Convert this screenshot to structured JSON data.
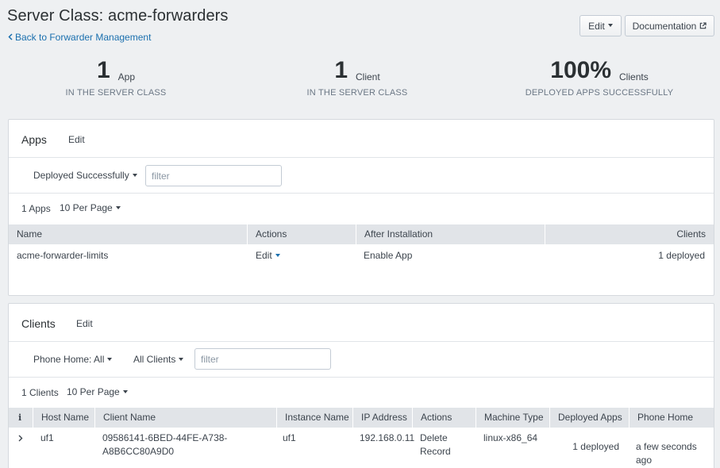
{
  "header": {
    "title": "Server Class: acme-forwarders",
    "back_link": "Back to Forwarder Management",
    "edit_button": "Edit",
    "doc_button": "Documentation"
  },
  "stats": [
    {
      "value": "1",
      "unit": "App",
      "label": "IN THE SERVER CLASS"
    },
    {
      "value": "1",
      "unit": "Client",
      "label": "IN THE SERVER CLASS"
    },
    {
      "value": "100%",
      "unit": "Clients",
      "label": "DEPLOYED APPS SUCCESSFULLY"
    }
  ],
  "apps": {
    "title": "Apps",
    "edit": "Edit",
    "status_filter": "Deployed Successfully",
    "filter_placeholder": "filter",
    "count": "1 Apps",
    "per_page": "10 Per Page",
    "columns": [
      "Name",
      "Actions",
      "After Installation",
      "Clients"
    ],
    "rows": [
      {
        "name": "acme-forwarder-limits",
        "action": "Edit",
        "after_install": "Enable App",
        "clients": "1 deployed"
      }
    ]
  },
  "clients": {
    "title": "Clients",
    "edit": "Edit",
    "phone_home_filter": "Phone Home: All",
    "clients_filter": "All Clients",
    "filter_placeholder": "filter",
    "count": "1 Clients",
    "per_page": "10 Per Page",
    "columns": [
      "i",
      "Host Name",
      "Client Name",
      "Instance Name",
      "IP Address",
      "Actions",
      "Machine Type",
      "Deployed Apps",
      "Phone Home"
    ],
    "rows": [
      {
        "host_name": "uf1",
        "client_name": "09586141-6BED-44FE-A738-A8B6CC80A9D0",
        "instance_name": "uf1",
        "ip_address": "192.168.0.11",
        "action": "Delete Record",
        "machine_type": "linux-x86_64",
        "deployed_apps": "1 deployed",
        "phone_home": "a few seconds ago"
      }
    ]
  }
}
